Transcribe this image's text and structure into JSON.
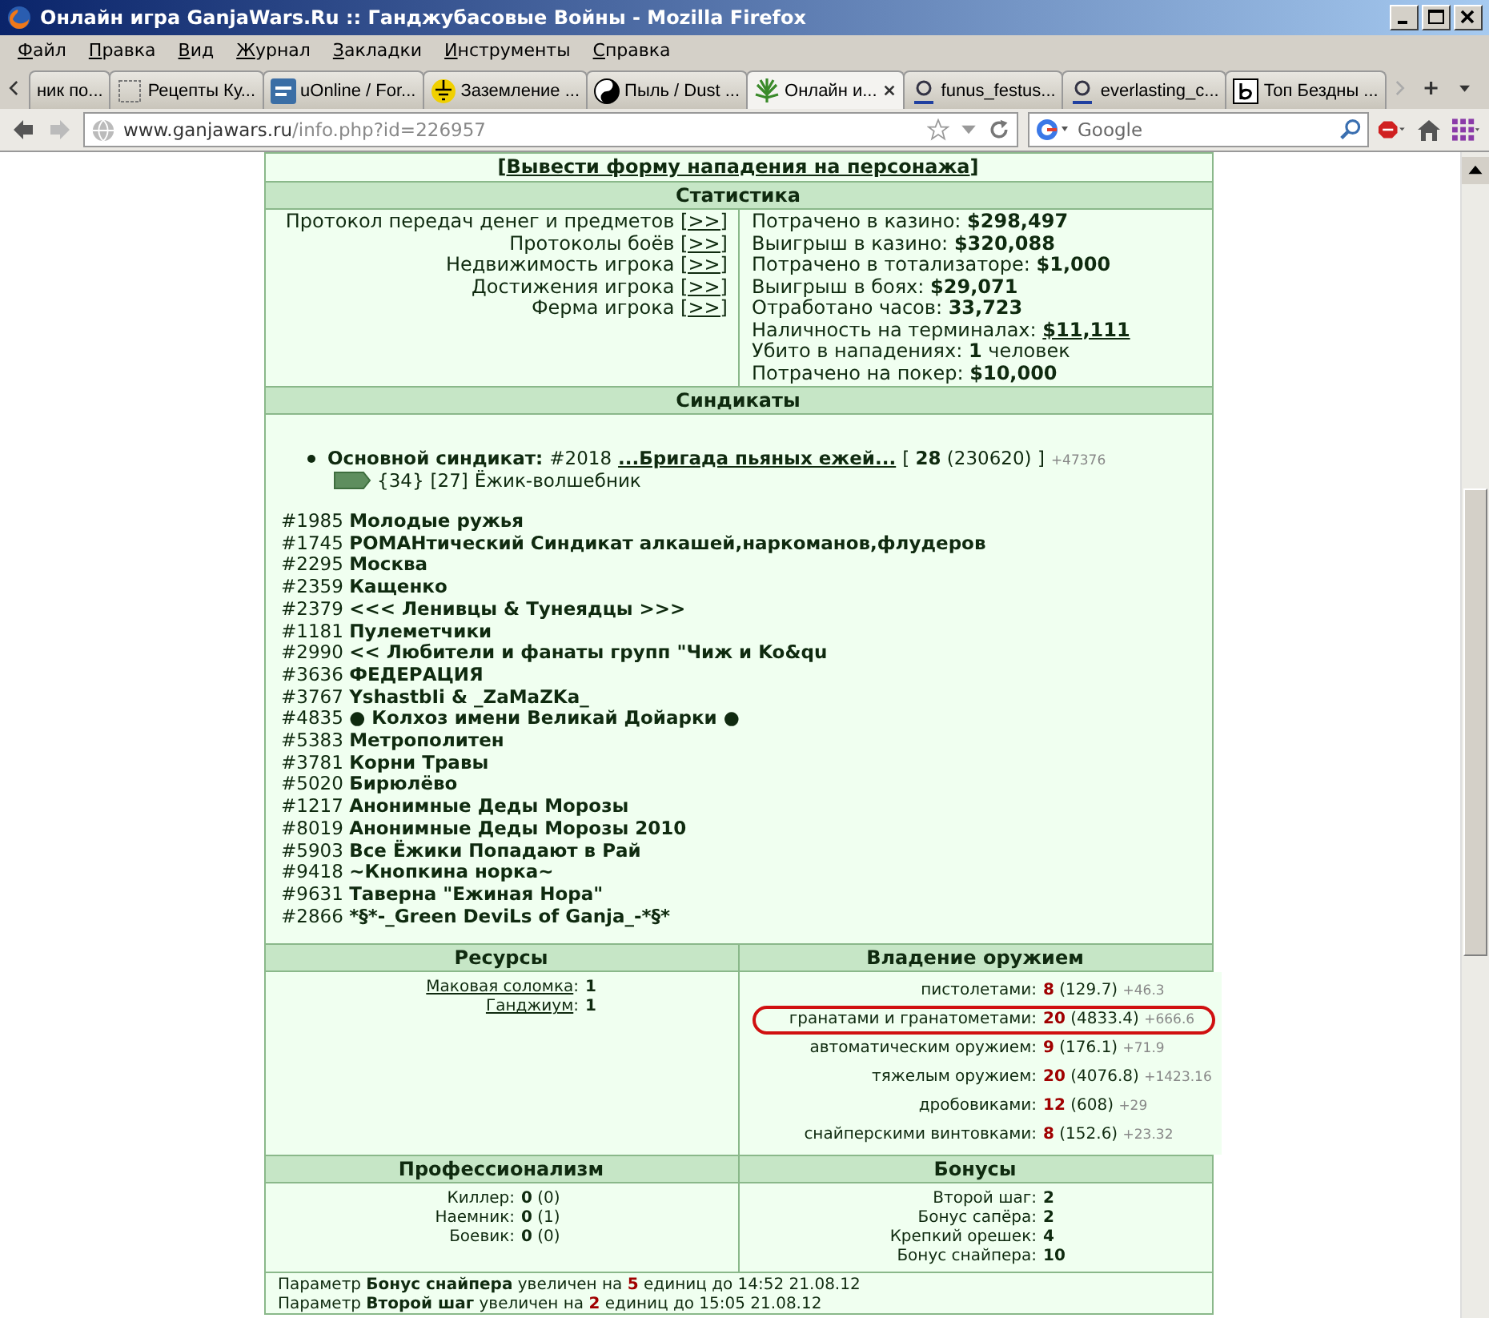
{
  "window": {
    "title": "Онлайн игра GanjaWars.Ru :: Ганджубасовые Войны - Mozilla Firefox"
  },
  "menu": [
    "Файл",
    "Правка",
    "Вид",
    "Журнал",
    "Закладки",
    "Инструменты",
    "Справка"
  ],
  "tabs": [
    {
      "label": "ник по...",
      "kind": "none",
      "selected": false
    },
    {
      "label": "Рецепты Ку...",
      "kind": "page",
      "selected": false
    },
    {
      "label": "uOnline / For...",
      "kind": "square",
      "selected": false
    },
    {
      "label": "Заземление ...",
      "kind": "ground",
      "selected": false
    },
    {
      "label": "Пыль / Dust ...",
      "kind": "yinyang",
      "selected": false
    },
    {
      "label": "Онлайн и...",
      "kind": "leaf",
      "selected": true
    },
    {
      "label": "funus_festus...",
      "kind": "user",
      "selected": false
    },
    {
      "label": "everlasting_c...",
      "kind": "user",
      "selected": false
    },
    {
      "label": "Топ Бездны ...",
      "kind": "frame",
      "selected": false
    }
  ],
  "address": {
    "host": "www.ganjawars.ru",
    "path": "/info.php?id=226957"
  },
  "search": {
    "placeholder": "Google"
  },
  "attack_link": {
    "open": "[",
    "label": "Вывести форму нападения на персонажа",
    "close": "]"
  },
  "statistics": {
    "title": "Статистика",
    "protocols": [
      {
        "label": "Протокол передач денег и предметов",
        "link": "[>>]"
      },
      {
        "label": "Протоколы боёв",
        "link": "[>>]"
      },
      {
        "label": "Недвижимость игрока",
        "link": "[>>]"
      },
      {
        "label": "Достижения игрока",
        "link": "[>>]"
      },
      {
        "label": "Ферма игрока",
        "link": "[>>]"
      }
    ],
    "figures": [
      {
        "label": "Потрачено в казино:",
        "value": "$298,497",
        "kind": "text"
      },
      {
        "label": "Выигрыш в казино:",
        "value": "$320,088",
        "kind": "text"
      },
      {
        "label": "Потрачено в тотализаторе:",
        "value": "$1,000",
        "kind": "text"
      },
      {
        "label": "Выигрыш в боях:",
        "value": "$29,071",
        "kind": "text"
      },
      {
        "label": "Отработано часов:",
        "value": "33,723",
        "kind": "text"
      },
      {
        "label": "Наличность на терминалах:",
        "value": "$11,111",
        "kind": "link"
      },
      {
        "label": "Убито в нападениях:",
        "value": "1",
        "unit": "человек",
        "kind": "text"
      },
      {
        "label": "Потрачено на покер:",
        "value": "$10,000",
        "kind": "text"
      }
    ]
  },
  "syndicates": {
    "title": "Синдикаты",
    "main": {
      "label": "Основной синдикат:",
      "number": "#2018",
      "name": "...Бригада пьяных ежей...",
      "open": "[",
      "rank": "28",
      "points": "(230620)",
      "close": "]",
      "delta": "+47376",
      "sign": "{34}",
      "level": "[27]",
      "rank_title": "Ёжик-волшебник"
    },
    "list": [
      {
        "number": "#1985",
        "name": "Молодые ружья"
      },
      {
        "number": "#1745",
        "name": "РОМАНтический Синдикат алкашей,наркоманов,флудеров"
      },
      {
        "number": "#2295",
        "name": "Москва"
      },
      {
        "number": "#2359",
        "name": "Кащенко"
      },
      {
        "number": "#2379",
        "name": "<<< Ленивцы & Тунеядцы >>>"
      },
      {
        "number": "#1181",
        "name": "Пулеметчики"
      },
      {
        "number": "#2990",
        "name": "<< Любители и фанаты групп \"Чиж и Ko&qu"
      },
      {
        "number": "#3636",
        "name": "ФЕДЕРАЦИЯ"
      },
      {
        "number": "#3767",
        "name": "YshastbIi & _ZaMaZKa_"
      },
      {
        "number": "#4835",
        "name": "● Колхоз имени Великай Дойарки ●"
      },
      {
        "number": "#5383",
        "name": "Метрополитен"
      },
      {
        "number": "#3781",
        "name": "Корни Травы"
      },
      {
        "number": "#5020",
        "name": "Бирюлёво"
      },
      {
        "number": "#1217",
        "name": "Анонимные Деды Морозы"
      },
      {
        "number": "#8019",
        "name": "Анонимные Деды Морозы 2010"
      },
      {
        "number": "#5903",
        "name": "Все Ёжики Попадают в Рай"
      },
      {
        "number": "#9418",
        "name": "~Кнопкина норка~"
      },
      {
        "number": "#9631",
        "name": "Таверна \"Ежиная Нора\""
      },
      {
        "number": "#2866",
        "name": "*§*-_Green DeviLs of Ganja_-*§*"
      }
    ]
  },
  "resources": {
    "title": "Ресурсы",
    "items": [
      {
        "name": "Маковая соломка",
        "separator": ":",
        "value": "1"
      },
      {
        "name": "Ганджиум",
        "separator": ":",
        "value": "1"
      }
    ]
  },
  "weapons": {
    "title": "Владение оружием",
    "items": [
      {
        "name": "пистолетами:",
        "level": "8",
        "exp": "(129.7)",
        "delta": "+46.3",
        "highlighted": false
      },
      {
        "name": "гранатами и гранатометами:",
        "level": "20",
        "exp": "(4833.4)",
        "delta": "+666.6",
        "highlighted": true
      },
      {
        "name": "автоматическим оружием:",
        "level": "9",
        "exp": "(176.1)",
        "delta": "+71.9",
        "highlighted": false
      },
      {
        "name": "тяжелым оружием:",
        "level": "20",
        "exp": "(4076.8)",
        "delta": "+1423.16",
        "highlighted": false
      },
      {
        "name": "дробовиками:",
        "level": "12",
        "exp": "(608)",
        "delta": "+29",
        "highlighted": false
      },
      {
        "name": "снайперскими винтовками:",
        "level": "8",
        "exp": "(152.6)",
        "delta": "+23.32",
        "highlighted": false
      }
    ]
  },
  "professions": {
    "title": "Профессионализм",
    "items": [
      {
        "name": "Киллер:",
        "value": "0",
        "extra": "(0)"
      },
      {
        "name": "Наемник:",
        "value": "0",
        "extra": "(1)"
      },
      {
        "name": "Боевик:",
        "value": "0",
        "extra": "(0)"
      }
    ]
  },
  "bonuses": {
    "title": "Бонусы",
    "items": [
      {
        "name": "Второй шаг:",
        "value": "2"
      },
      {
        "name": "Бонус сапёра:",
        "value": "2"
      },
      {
        "name": "Крепкий орешек:",
        "value": "4"
      },
      {
        "name": "Бонус снайпера:",
        "value": "10"
      }
    ]
  },
  "log": [
    {
      "text_1": "Параметр",
      "param": "Бонус снайпера",
      "text_2": "увеличен на",
      "amount": "5",
      "text_3": "единиц до 14:52 21.08.12"
    },
    {
      "text_1": "Параметр",
      "param": "Второй шаг",
      "text_2": "увеличен на",
      "amount": "2",
      "text_3": "единиц до 15:05 21.08.12"
    }
  ]
}
